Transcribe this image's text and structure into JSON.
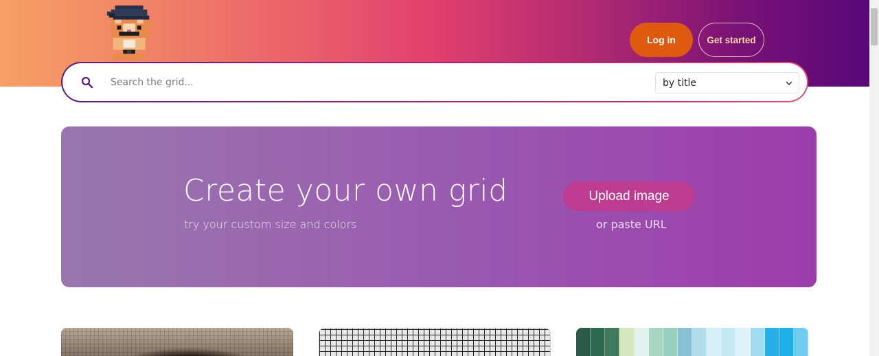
{
  "header": {
    "login_label": "Log in",
    "start_label": "Get started",
    "logo_icon": "pixel-cat-beret-logo"
  },
  "search": {
    "placeholder": "Search the grid...",
    "icon": "search-icon",
    "filter_selected": "by title"
  },
  "banner": {
    "title": "Create your own grid",
    "subtitle": "try your custom size and colors",
    "upload_label": "Upload image",
    "paste_label": "or paste URL"
  },
  "colors": {
    "login": "#df5a0e",
    "upload": "#bd3c8f",
    "card3_palette": [
      "#2c5a46",
      "#2e6a52",
      "#3d7a5e",
      "#d6e6bd",
      "#e0f1ee",
      "#a9d6c2",
      "#9ad0bf",
      "#87c1d4",
      "#b1dcea",
      "#d5f0f6",
      "#c4e8f4",
      "#ddf3fb",
      "#a2dbf2",
      "#28b0e6",
      "#1fb0e8",
      "#6fcdf2"
    ]
  }
}
